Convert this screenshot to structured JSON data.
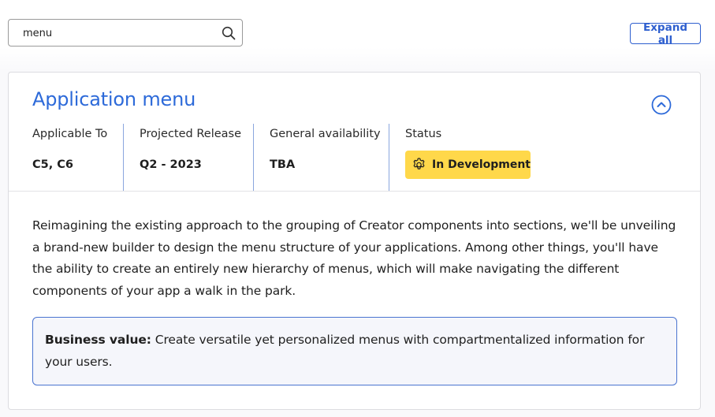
{
  "search": {
    "value": "menu",
    "icon": "search-icon"
  },
  "toolbar": {
    "expand_all_label": "Expand all"
  },
  "card": {
    "title": "Application menu",
    "collapse_icon": "chevron-up-circle-icon",
    "meta": [
      {
        "label": "Applicable To",
        "value": "C5, C6"
      },
      {
        "label": "Projected Release",
        "value": "Q2 - 2023"
      },
      {
        "label": "General availability",
        "value": "TBA"
      }
    ],
    "status": {
      "label": "Status",
      "value": "In Development",
      "icon": "gear-icon",
      "color": "#ffd84a"
    },
    "description": "Reimagining the existing approach to the grouping of Creator components into sections, we'll be unveiling a brand-new builder to design the menu structure of your applications. Among other things, you'll have the ability to create an entirely new hierarchy of menus, which will make navigating the different components of your app a walk in the park.",
    "business_value": {
      "label": "Business value:",
      "text": "Create versatile yet personalized menus with compartmentalized information for your users."
    }
  },
  "colors": {
    "accent": "#2d6ad9",
    "button_border": "#2e5fcf",
    "status_badge": "#ffd84a"
  }
}
